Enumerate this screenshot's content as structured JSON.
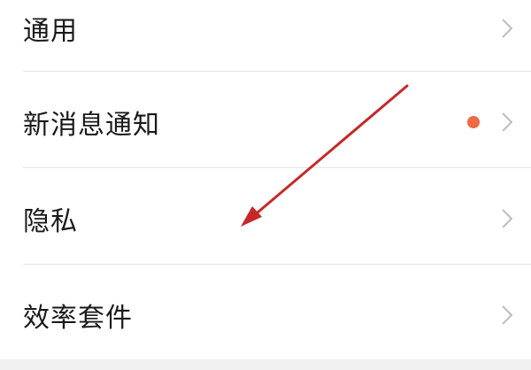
{
  "settings": {
    "items": [
      {
        "label": "通用",
        "has_badge": false,
        "chevron_icon": "chevron-right-icon"
      },
      {
        "label": "新消息通知",
        "has_badge": true,
        "badge_color": "#ee6a43",
        "chevron_icon": "chevron-right-icon"
      },
      {
        "label": "隐私",
        "has_badge": false,
        "chevron_icon": "chevron-right-icon"
      },
      {
        "label": "效率套件",
        "has_badge": false,
        "chevron_icon": "chevron-right-icon"
      }
    ]
  },
  "annotation": {
    "icon": "red-arrow",
    "color": "#c62828"
  }
}
